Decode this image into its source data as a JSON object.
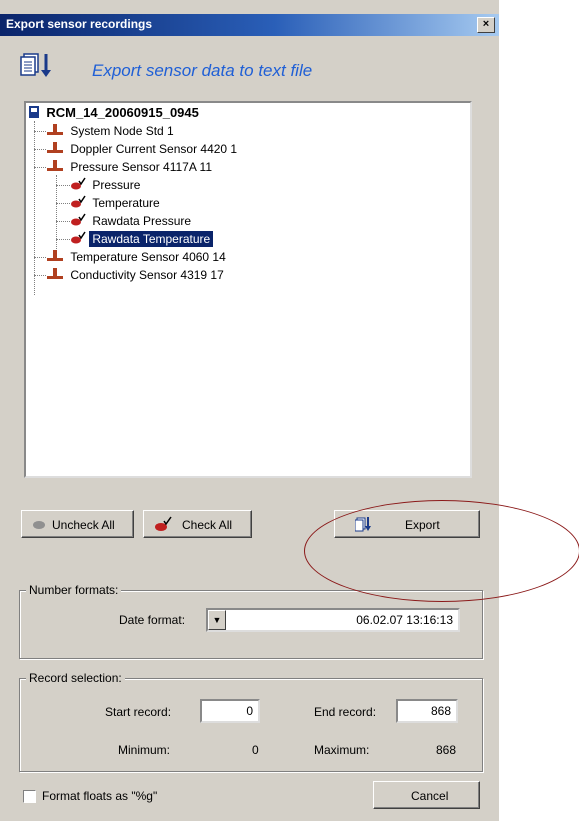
{
  "window": {
    "title": "Export sensor recordings",
    "close_label": "×"
  },
  "header": {
    "title": "Export sensor data to text file"
  },
  "tree": {
    "root": "RCM_14_20060915_0945",
    "nodes": [
      {
        "label": "System Node Std 1"
      },
      {
        "label": "Doppler Current Sensor 4420 1"
      },
      {
        "label": "Pressure Sensor 4117A 11"
      },
      {
        "label": "Pressure"
      },
      {
        "label": "Temperature"
      },
      {
        "label": "Rawdata Pressure"
      },
      {
        "label": "Rawdata Temperature",
        "selected": true
      },
      {
        "label": "Temperature Sensor 4060 14"
      },
      {
        "label": "Conductivity Sensor 4319 17"
      }
    ]
  },
  "buttons": {
    "uncheck_all": "Uncheck All",
    "check_all": "Check All",
    "export": "Export",
    "cancel": "Cancel"
  },
  "number_formats": {
    "legend": "Number formats:",
    "date_format_label": "Date format:",
    "date_format_value": "06.02.07 13:16:13"
  },
  "record_selection": {
    "legend": "Record selection:",
    "start_label": "Start record:",
    "start_value": "0",
    "end_label": "End record:",
    "end_value": "868",
    "min_label": "Minimum:",
    "min_value": "0",
    "max_label": "Maximum:",
    "max_value": "868"
  },
  "format_floats": {
    "label": "Format floats as \"%g\"",
    "checked": false
  },
  "colors": {
    "accent": "#1f5fd6",
    "selection": "#0a246a",
    "annotation": "#8b1a1a",
    "dialog_bg": "#d4d0c8"
  }
}
